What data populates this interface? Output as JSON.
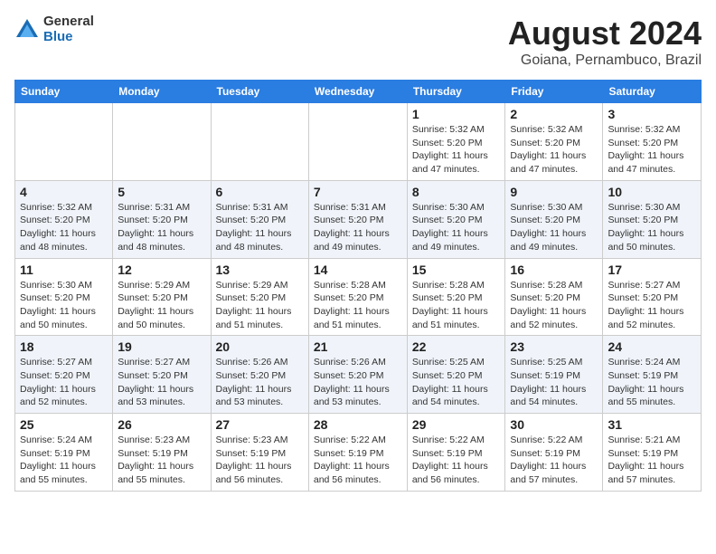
{
  "logo": {
    "general": "General",
    "blue": "Blue"
  },
  "header": {
    "month_year": "August 2024",
    "location": "Goiana, Pernambuco, Brazil"
  },
  "weekdays": [
    "Sunday",
    "Monday",
    "Tuesday",
    "Wednesday",
    "Thursday",
    "Friday",
    "Saturday"
  ],
  "weeks": [
    [
      {
        "day": "",
        "info": ""
      },
      {
        "day": "",
        "info": ""
      },
      {
        "day": "",
        "info": ""
      },
      {
        "day": "",
        "info": ""
      },
      {
        "day": "1",
        "info": "Sunrise: 5:32 AM\nSunset: 5:20 PM\nDaylight: 11 hours\nand 47 minutes."
      },
      {
        "day": "2",
        "info": "Sunrise: 5:32 AM\nSunset: 5:20 PM\nDaylight: 11 hours\nand 47 minutes."
      },
      {
        "day": "3",
        "info": "Sunrise: 5:32 AM\nSunset: 5:20 PM\nDaylight: 11 hours\nand 47 minutes."
      }
    ],
    [
      {
        "day": "4",
        "info": "Sunrise: 5:32 AM\nSunset: 5:20 PM\nDaylight: 11 hours\nand 48 minutes."
      },
      {
        "day": "5",
        "info": "Sunrise: 5:31 AM\nSunset: 5:20 PM\nDaylight: 11 hours\nand 48 minutes."
      },
      {
        "day": "6",
        "info": "Sunrise: 5:31 AM\nSunset: 5:20 PM\nDaylight: 11 hours\nand 48 minutes."
      },
      {
        "day": "7",
        "info": "Sunrise: 5:31 AM\nSunset: 5:20 PM\nDaylight: 11 hours\nand 49 minutes."
      },
      {
        "day": "8",
        "info": "Sunrise: 5:30 AM\nSunset: 5:20 PM\nDaylight: 11 hours\nand 49 minutes."
      },
      {
        "day": "9",
        "info": "Sunrise: 5:30 AM\nSunset: 5:20 PM\nDaylight: 11 hours\nand 49 minutes."
      },
      {
        "day": "10",
        "info": "Sunrise: 5:30 AM\nSunset: 5:20 PM\nDaylight: 11 hours\nand 50 minutes."
      }
    ],
    [
      {
        "day": "11",
        "info": "Sunrise: 5:30 AM\nSunset: 5:20 PM\nDaylight: 11 hours\nand 50 minutes."
      },
      {
        "day": "12",
        "info": "Sunrise: 5:29 AM\nSunset: 5:20 PM\nDaylight: 11 hours\nand 50 minutes."
      },
      {
        "day": "13",
        "info": "Sunrise: 5:29 AM\nSunset: 5:20 PM\nDaylight: 11 hours\nand 51 minutes."
      },
      {
        "day": "14",
        "info": "Sunrise: 5:28 AM\nSunset: 5:20 PM\nDaylight: 11 hours\nand 51 minutes."
      },
      {
        "day": "15",
        "info": "Sunrise: 5:28 AM\nSunset: 5:20 PM\nDaylight: 11 hours\nand 51 minutes."
      },
      {
        "day": "16",
        "info": "Sunrise: 5:28 AM\nSunset: 5:20 PM\nDaylight: 11 hours\nand 52 minutes."
      },
      {
        "day": "17",
        "info": "Sunrise: 5:27 AM\nSunset: 5:20 PM\nDaylight: 11 hours\nand 52 minutes."
      }
    ],
    [
      {
        "day": "18",
        "info": "Sunrise: 5:27 AM\nSunset: 5:20 PM\nDaylight: 11 hours\nand 52 minutes."
      },
      {
        "day": "19",
        "info": "Sunrise: 5:27 AM\nSunset: 5:20 PM\nDaylight: 11 hours\nand 53 minutes."
      },
      {
        "day": "20",
        "info": "Sunrise: 5:26 AM\nSunset: 5:20 PM\nDaylight: 11 hours\nand 53 minutes."
      },
      {
        "day": "21",
        "info": "Sunrise: 5:26 AM\nSunset: 5:20 PM\nDaylight: 11 hours\nand 53 minutes."
      },
      {
        "day": "22",
        "info": "Sunrise: 5:25 AM\nSunset: 5:20 PM\nDaylight: 11 hours\nand 54 minutes."
      },
      {
        "day": "23",
        "info": "Sunrise: 5:25 AM\nSunset: 5:19 PM\nDaylight: 11 hours\nand 54 minutes."
      },
      {
        "day": "24",
        "info": "Sunrise: 5:24 AM\nSunset: 5:19 PM\nDaylight: 11 hours\nand 55 minutes."
      }
    ],
    [
      {
        "day": "25",
        "info": "Sunrise: 5:24 AM\nSunset: 5:19 PM\nDaylight: 11 hours\nand 55 minutes."
      },
      {
        "day": "26",
        "info": "Sunrise: 5:23 AM\nSunset: 5:19 PM\nDaylight: 11 hours\nand 55 minutes."
      },
      {
        "day": "27",
        "info": "Sunrise: 5:23 AM\nSunset: 5:19 PM\nDaylight: 11 hours\nand 56 minutes."
      },
      {
        "day": "28",
        "info": "Sunrise: 5:22 AM\nSunset: 5:19 PM\nDaylight: 11 hours\nand 56 minutes."
      },
      {
        "day": "29",
        "info": "Sunrise: 5:22 AM\nSunset: 5:19 PM\nDaylight: 11 hours\nand 56 minutes."
      },
      {
        "day": "30",
        "info": "Sunrise: 5:22 AM\nSunset: 5:19 PM\nDaylight: 11 hours\nand 57 minutes."
      },
      {
        "day": "31",
        "info": "Sunrise: 5:21 AM\nSunset: 5:19 PM\nDaylight: 11 hours\nand 57 minutes."
      }
    ]
  ]
}
